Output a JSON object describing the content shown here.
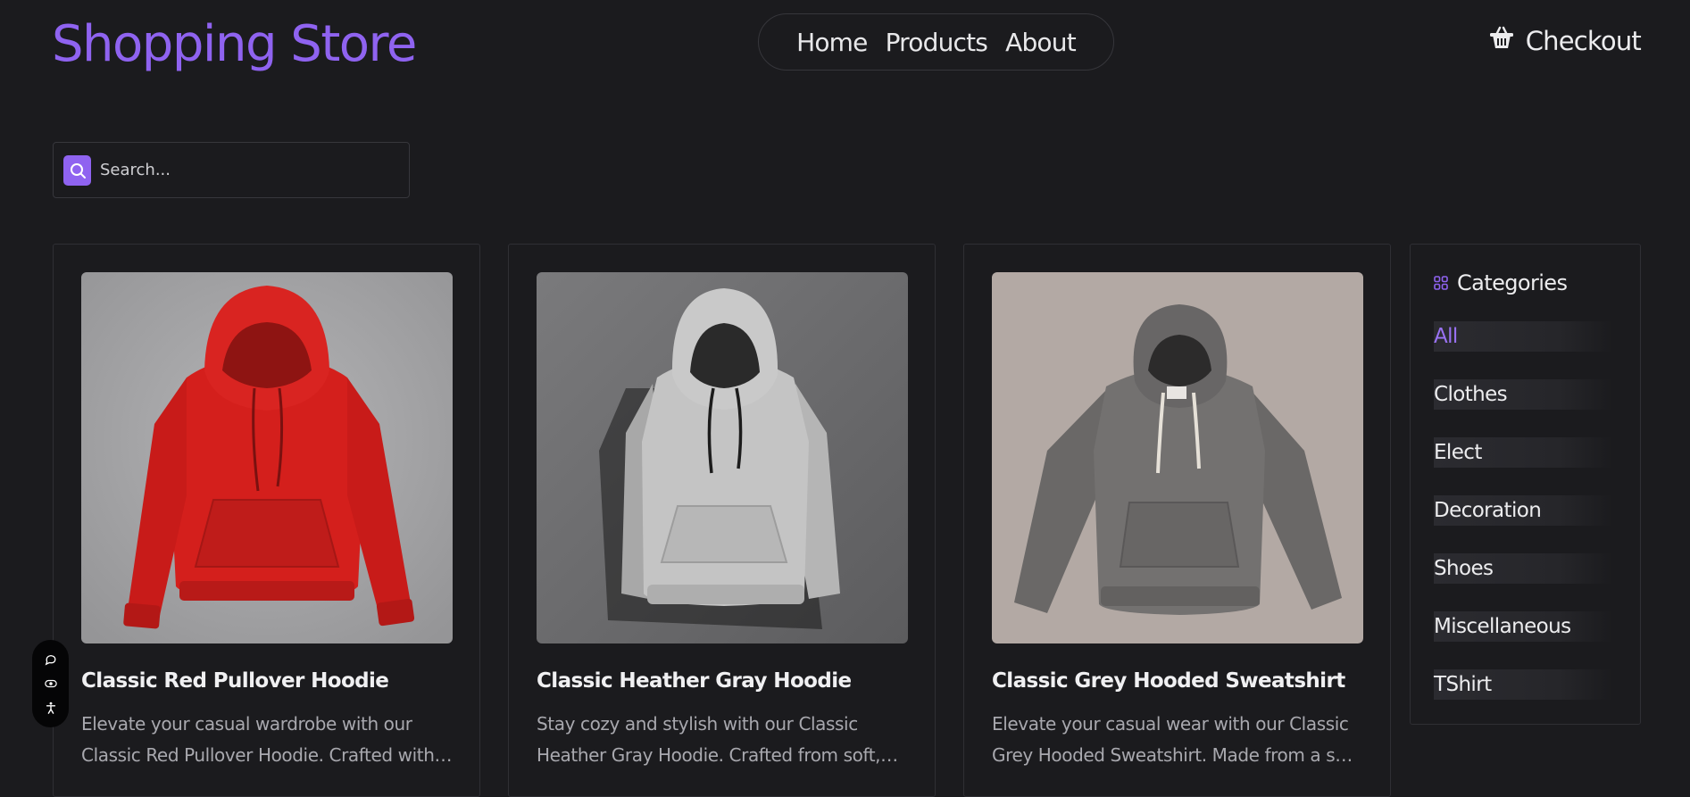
{
  "header": {
    "brand": "Shopping Store",
    "nav": [
      "Home",
      "Products",
      "About"
    ],
    "checkout_label": "Checkout"
  },
  "search": {
    "placeholder": "Search..."
  },
  "products": [
    {
      "title": "Classic Red Pullover Hoodie",
      "description": "Elevate your casual wardrobe with our Classic Red Pullover Hoodie. Crafted with a soft cotton...",
      "color": "#d9221f",
      "bg": "#a8a8aa"
    },
    {
      "title": "Classic Heather Gray Hoodie",
      "description": "Stay cozy and stylish with our Classic Heather Gray Hoodie. Crafted from soft, durable fabric, it...",
      "color": "#bdbdbd",
      "bg": "#6e6e70"
    },
    {
      "title": "Classic Grey Hooded Sweatshirt",
      "description": "Elevate your casual wear with our Classic Grey Hooded Sweatshirt. Made from a soft cotton...",
      "color": "#706e6d",
      "bg": "#b4aaa5"
    }
  ],
  "categories": {
    "title": "Categories",
    "items": [
      "All",
      "Clothes",
      "Elect",
      "Decoration",
      "Shoes",
      "Miscellaneous",
      "TShirt"
    ],
    "active": "All"
  },
  "colors": {
    "accent": "#8f63f0",
    "background": "#1b1b1e"
  },
  "icons": {
    "checkout": "basket-icon",
    "search": "search-icon",
    "categories": "grid-icon",
    "a11y": [
      "chat-icon",
      "eye-icon",
      "accessibility-icon"
    ]
  }
}
